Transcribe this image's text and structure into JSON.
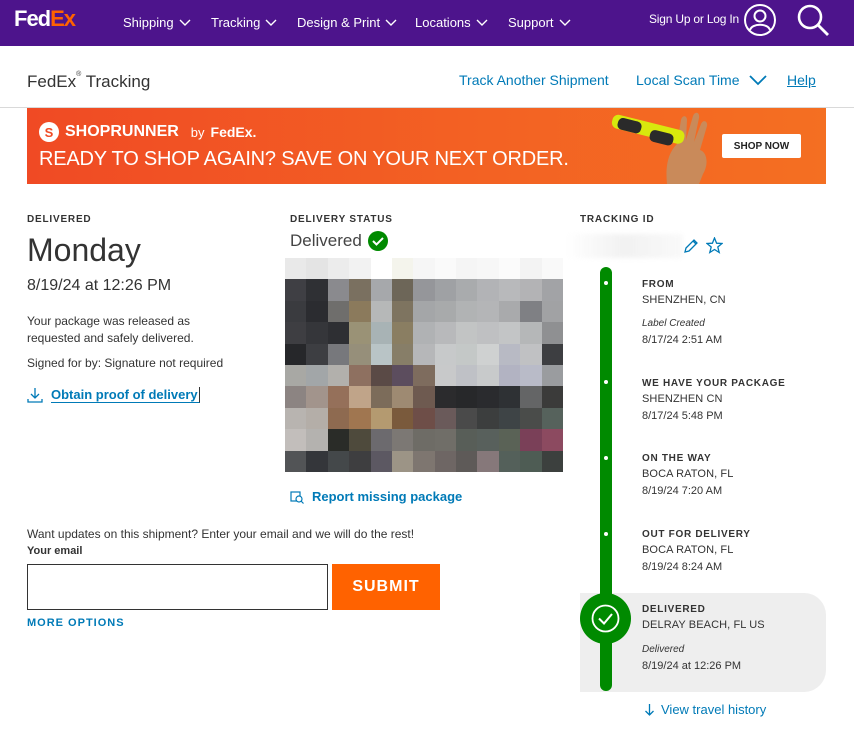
{
  "brand": {
    "logo_fed": "Fed",
    "logo_ex": "Ex",
    "purple": "#4d148c",
    "orange": "#ff6200",
    "link_blue": "#007ab7",
    "green": "#008a00"
  },
  "topnav": {
    "items": [
      {
        "label": "Shipping"
      },
      {
        "label": "Tracking"
      },
      {
        "label": "Design & Print"
      },
      {
        "label": "Locations"
      },
      {
        "label": "Support"
      }
    ],
    "signin": "Sign Up or Log In",
    "user_icon": "user-circle-icon",
    "search_icon": "search-icon"
  },
  "subheader": {
    "title": "FedEx",
    "title_mark": "®",
    "title_suffix": " Tracking",
    "track_another": "Track Another Shipment",
    "local_scan": "Local Scan Time",
    "help": "Help"
  },
  "banner": {
    "badge": "S",
    "brand": "SHOPRUNNER",
    "by": "by",
    "fedex": "FedEx.",
    "headline": "READY TO SHOP AGAIN? SAVE ON YOUR NEXT ORDER.",
    "cta": "SHOP NOW"
  },
  "delivered": {
    "label": "DELIVERED",
    "day": "Monday",
    "datetime": "8/19/24 at 12:26 PM",
    "released": "Your package was released as requested and safely delivered.",
    "signed": "Signed for by: Signature not required",
    "proof_link": "Obtain proof of delivery"
  },
  "delivery_status": {
    "label": "DELIVERY STATUS",
    "value": "Delivered",
    "report_link": "Report missing package"
  },
  "email": {
    "prompt": "Want updates on this shipment? Enter your email and we will do the rest!",
    "label": "Your email",
    "value": "",
    "submit": "SUBMIT",
    "more_options": "MORE OPTIONS"
  },
  "tracking": {
    "label": "TRACKING ID",
    "events": [
      {
        "title": "FROM",
        "location": "SHENZHEN, CN",
        "note": "Label Created",
        "time": "8/17/24 2:51 AM"
      },
      {
        "title": "WE HAVE YOUR PACKAGE",
        "location": "SHENZHEN CN",
        "time": "8/17/24 5:48 PM"
      },
      {
        "title": "ON THE WAY",
        "location": "BOCA RATON, FL",
        "time": "8/19/24 7:20 AM"
      },
      {
        "title": "OUT FOR DELIVERY",
        "location": "BOCA RATON, FL",
        "time": "8/19/24 8:24 AM"
      },
      {
        "title": "DELIVERED",
        "location": "DELRAY BEACH, FL US",
        "note": "Delivered",
        "time": "8/19/24 at 12:26 PM"
      }
    ],
    "travel_history": "View travel history"
  }
}
